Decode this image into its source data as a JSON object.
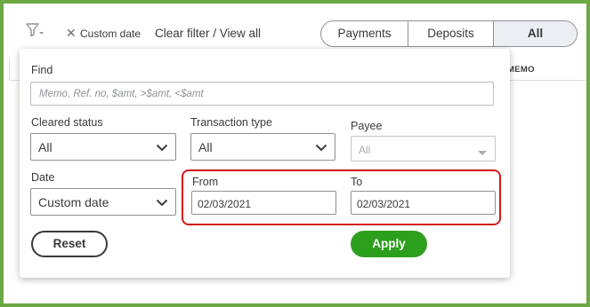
{
  "toolbar": {
    "filter_icon": "filter-funnel-icon",
    "close_icon": "close-icon",
    "close_glyph": "✕",
    "active_filter_label": "Custom date",
    "clear_filter_link": "Clear filter / View all",
    "segments": [
      "Payments",
      "Deposits",
      "All"
    ],
    "selected_segment": "All"
  },
  "table": {
    "memo_header": "MEMO"
  },
  "filter_panel": {
    "find": {
      "label": "Find",
      "placeholder": "Memo, Ref. no, $amt, >$amt, <$amt"
    },
    "cleared_status": {
      "label": "Cleared status",
      "value": "All"
    },
    "transaction_type": {
      "label": "Transaction type",
      "value": "All"
    },
    "payee": {
      "label": "Payee",
      "value": "All"
    },
    "date": {
      "label": "Date",
      "value": "Custom date"
    },
    "from": {
      "label": "From",
      "value": "02/03/2021"
    },
    "to": {
      "label": "To",
      "value": "02/03/2021"
    },
    "reset_label": "Reset",
    "apply_label": "Apply"
  },
  "colors": {
    "outer_border": "#6da844",
    "apply_green": "#2ca01c",
    "highlight_red": "#d31b1b"
  }
}
